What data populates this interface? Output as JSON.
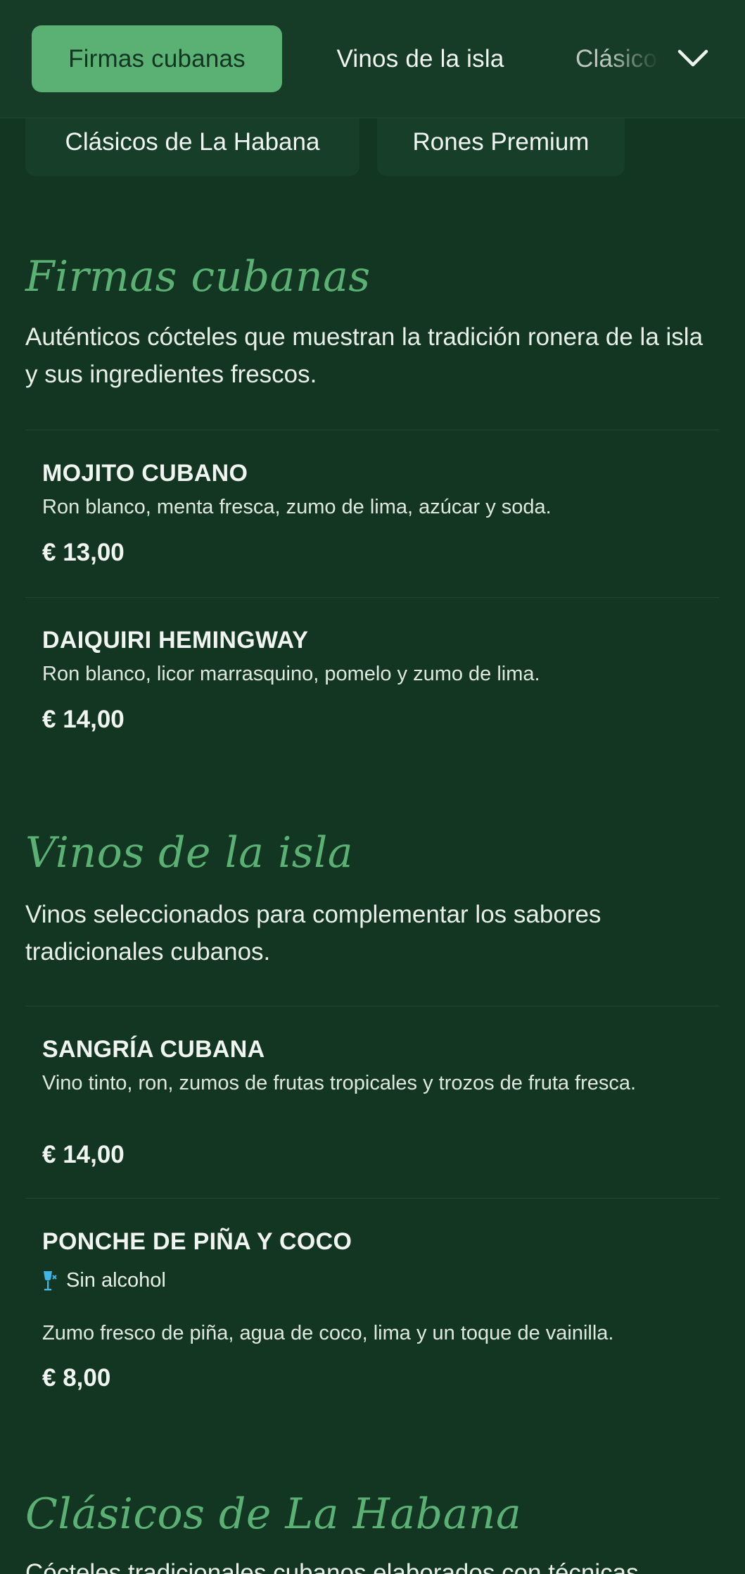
{
  "nav": {
    "tabs": [
      {
        "label": "Firmas cubanas",
        "active": true
      },
      {
        "label": "Vinos de la isla",
        "active": false
      },
      {
        "label": "Clásicos",
        "active": false
      }
    ],
    "chips": [
      {
        "label": "Clásicos de La Habana"
      },
      {
        "label": "Rones Premium"
      }
    ],
    "expand_icon": "chevron-down-icon"
  },
  "sections": [
    {
      "title": "Firmas cubanas",
      "description": "Auténticos cócteles que muestran la tradición ronera de la isla y sus ingredientes frescos.",
      "items": [
        {
          "name": "MOJITO CUBANO",
          "description": "Ron blanco, menta fresca, zumo de lima, azúcar y soda.",
          "price": "€ 13,00"
        },
        {
          "name": "DAIQUIRI HEMINGWAY",
          "description": "Ron blanco, licor marrasquino, pomelo y zumo de lima.",
          "price": "€ 14,00"
        }
      ]
    },
    {
      "title": "Vinos de la isla",
      "description": "Vinos seleccionados para complementar los sabores tradicionales cubanos.",
      "items": [
        {
          "name": "SANGRÍA CUBANA",
          "description": "Vino tinto, ron, zumos de frutas tropicales y trozos de fruta fresca.",
          "price": "€ 14,00"
        },
        {
          "name": "PONCHE DE PIÑA Y COCO",
          "badge": "Sin alcohol",
          "badge_icon": "no-alcohol-glass-icon",
          "description": "Zumo fresco de piña, agua de coco, lima y un toque de vainilla.",
          "price": "€ 8,00"
        }
      ]
    },
    {
      "title": "Clásicos de La Habana",
      "description": "Cócteles tradicionales cubanos elaborados con técnicas"
    }
  ],
  "colors": {
    "background": "#133622",
    "accent": "#5bb173",
    "badge_icon": "#3fb6e8"
  }
}
